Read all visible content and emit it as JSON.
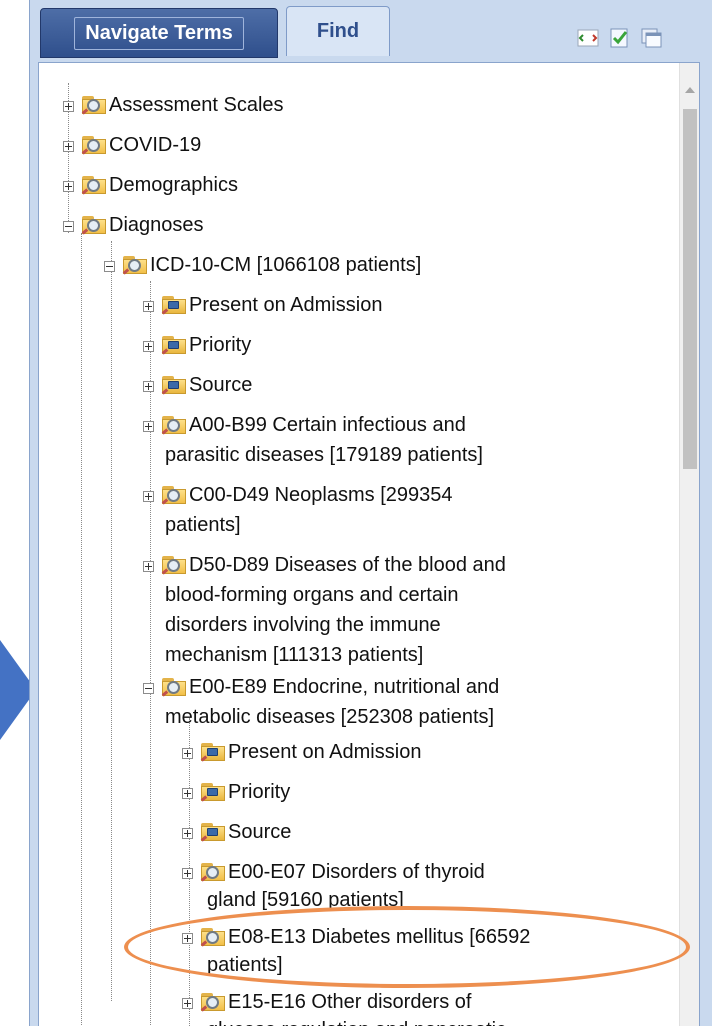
{
  "tabs": {
    "navigate": "Navigate Terms",
    "find": "Find"
  },
  "toolbar_icons": [
    "refresh-icon",
    "check-icon",
    "window-icon"
  ],
  "tree": [
    {
      "lines": [
        "Assessment Scales"
      ]
    },
    {
      "lines": [
        "COVID-19"
      ]
    },
    {
      "lines": [
        "Demographics"
      ]
    },
    {
      "lines": [
        "Diagnoses"
      ]
    },
    {
      "lines": [
        "ICD-10-CM [1066108 patients]"
      ]
    },
    {
      "lines": [
        "Present on Admission"
      ]
    },
    {
      "lines": [
        "Priority"
      ]
    },
    {
      "lines": [
        "Source"
      ]
    },
    {
      "lines": [
        "A00-B99 Certain infectious and",
        "parasitic diseases [179189 patients]"
      ]
    },
    {
      "lines": [
        "C00-D49 Neoplasms [299354",
        "patients]"
      ]
    },
    {
      "lines": [
        "D50-D89 Diseases of the blood and",
        "blood-forming organs and certain",
        "disorders involving the immune",
        "mechanism [111313 patients]"
      ]
    },
    {
      "lines": [
        "E00-E89 Endocrine, nutritional and",
        "metabolic diseases [252308 patients]"
      ]
    },
    {
      "lines": [
        "Present on Admission"
      ]
    },
    {
      "lines": [
        "Priority"
      ]
    },
    {
      "lines": [
        "Source"
      ]
    },
    {
      "lines": [
        "E00-E07 Disorders of thyroid",
        "gland [59160 patients]"
      ]
    },
    {
      "lines": [
        "E08-E13 Diabetes mellitus [66592",
        "patients]"
      ]
    },
    {
      "lines": [
        "E15-E16 Other disorders of",
        "glucose regulation and pancreatic"
      ]
    }
  ],
  "colors": {
    "tab_active": "#2f4f8c",
    "panel_bg": "#c9d9ee",
    "highlight": "#ed8f4f",
    "arrow": "#4472c4"
  }
}
